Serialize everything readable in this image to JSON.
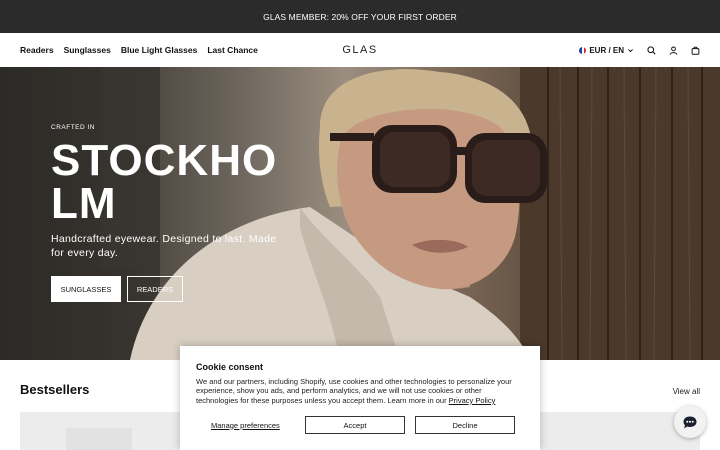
{
  "announcement": {
    "text": "GLAS MEMBER: 20% OFF YOUR FIRST ORDER"
  },
  "nav": {
    "links": [
      "Readers",
      "Sunglasses",
      "Blue Light Glasses",
      "Last Chance"
    ],
    "logo": "GLAS",
    "currency": "EUR / EN",
    "icons": [
      "flag-icon",
      "chevron-down-icon",
      "search-icon",
      "account-icon",
      "cart-icon"
    ]
  },
  "hero": {
    "eyebrow": "CRAFTED IN",
    "headline": "STOCKHOLM",
    "subtitle": "Handcrafted eyewear. Designed to last. Made for every day.",
    "buttons": {
      "primary": "SUNGLASSES",
      "secondary": "READERS"
    }
  },
  "section": {
    "title": "Bestsellers",
    "view_all": "View all"
  },
  "cookie": {
    "title": "Cookie consent",
    "body": "We and our partners, including Shopify, use cookies and other technologies to personalize your experience, show you ads, and perform analytics, and we will not use cookies or other technologies for these purposes unless you accept them. Learn more in our ",
    "policy_link": "Privacy Policy",
    "manage": "Manage preferences",
    "accept": "Accept",
    "decline": "Decline"
  },
  "chat": {
    "icon": "chat-icon"
  },
  "colors": {
    "announcement_bg": "#2b2b2b",
    "text": "#111111",
    "hero_text": "#ffffff"
  }
}
